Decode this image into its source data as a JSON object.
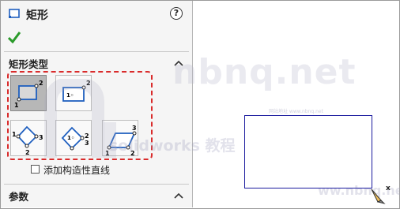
{
  "panel": {
    "title": "矩形",
    "help_symbol": "?",
    "section_rect_type": {
      "label": "矩形类型"
    },
    "construction_checkbox": {
      "label": "添加构造性直线",
      "checked": false
    },
    "section_params": {
      "label": "参数"
    },
    "types": [
      {
        "name": "corner-rectangle",
        "selected": true
      },
      {
        "name": "center-rectangle",
        "selected": false
      },
      {
        "name": "3-point-corner-rectangle",
        "selected": false
      },
      {
        "name": "3-point-center-rectangle",
        "selected": false
      },
      {
        "name": "parallelogram",
        "selected": false
      }
    ],
    "glyphs": {
      "p1": "1",
      "p2": "2",
      "p3": "3",
      "center": "1◦"
    }
  },
  "watermark": {
    "big": "nbnq.net",
    "line": "solidworks 教程",
    "small": "网站地址 www.nbnq.net",
    "corner": "ww.nbnq.net"
  },
  "cursor_label": "x",
  "colors": {
    "accent_red": "#d92b2b",
    "ok_green": "#2a9a2a",
    "sketch_blue": "#1a1a9e"
  },
  "icons": [
    "rectangle-icon",
    "help-icon",
    "ok-check-icon",
    "chevron-up-icon",
    "pencil-cursor-icon"
  ]
}
